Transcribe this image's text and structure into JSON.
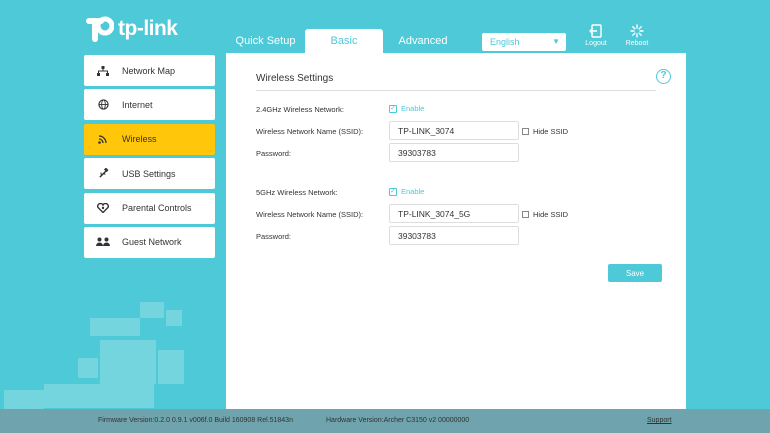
{
  "brand": {
    "logo_text": "tp-link"
  },
  "tabs": [
    {
      "label": "Quick Setup"
    },
    {
      "label": "Basic"
    },
    {
      "label": "Advanced"
    }
  ],
  "language": {
    "selected": "English"
  },
  "top_actions": {
    "logout": "Logout",
    "reboot": "Reboot"
  },
  "sidebar": {
    "items": [
      {
        "label": "Network Map",
        "icon": "network-map-icon"
      },
      {
        "label": "Internet",
        "icon": "globe-icon"
      },
      {
        "label": "Wireless",
        "icon": "wifi-icon"
      },
      {
        "label": "USB Settings",
        "icon": "usb-icon"
      },
      {
        "label": "Parental Controls",
        "icon": "heart-icon"
      },
      {
        "label": "Guest Network",
        "icon": "guests-icon"
      }
    ]
  },
  "panel": {
    "title": "Wireless Settings",
    "band24": {
      "label": "2.4GHz Wireless Network:",
      "enable_label": "Enable",
      "ssid_label": "Wireless Network Name (SSID):",
      "ssid_value": "TP-LINK_3074",
      "hide_ssid_label": "Hide SSID",
      "password_label": "Password:",
      "password_value": "39303783"
    },
    "band5": {
      "label": "5GHz Wireless Network:",
      "enable_label": "Enable",
      "ssid_label": "Wireless Network Name (SSID):",
      "ssid_value": "TP-LINK_3074_5G",
      "hide_ssid_label": "Hide SSID",
      "password_label": "Password:",
      "password_value": "39303783"
    },
    "save_label": "Save"
  },
  "footer": {
    "firmware": "Firmware Version:0.2.0 0.9.1 v006f.0 Build 160908 Rel.51843n",
    "hardware": "Hardware Version:Archer C3150 v2 00000000",
    "support": "Support"
  },
  "colors": {
    "accent": "#4dc9d7",
    "active": "#ffc60a",
    "footer": "#6fa3ad"
  }
}
